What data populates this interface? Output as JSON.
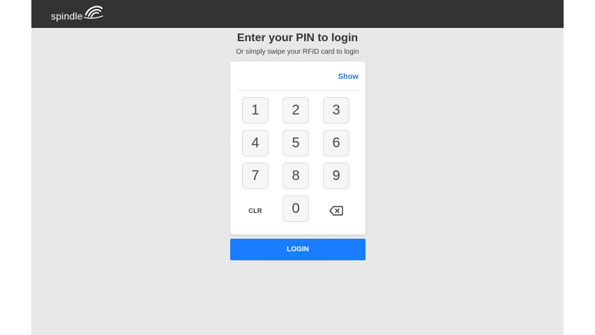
{
  "header": {
    "brand": "spindle",
    "logo_icon": "spindle-swirl-logo"
  },
  "login": {
    "title": "Enter your PIN to login",
    "subtitle": "Or simply swipe your RFID card to login",
    "pin_value": "",
    "show_label": "Show",
    "keys": {
      "k1": "1",
      "k2": "2",
      "k3": "3",
      "k4": "4",
      "k5": "5",
      "k6": "6",
      "k7": "7",
      "k8": "8",
      "k9": "9",
      "k0": "0",
      "clear": "CLR",
      "backspace_icon": "backspace-icon"
    },
    "submit_label": "LOGIN"
  },
  "colors": {
    "topbar": "#333333",
    "background": "#e9e9e9",
    "accent": "#1a7cff",
    "link": "#2a7bd4"
  }
}
